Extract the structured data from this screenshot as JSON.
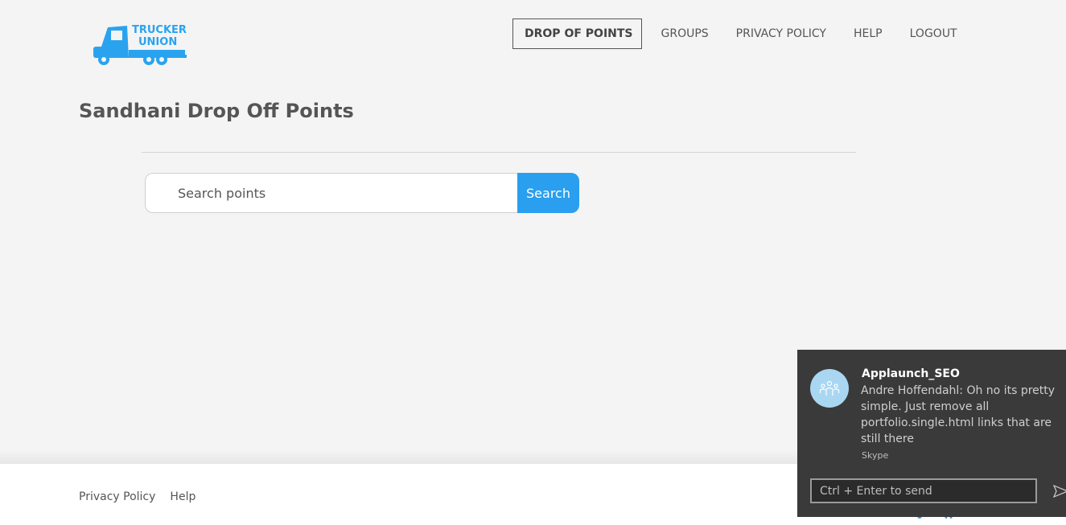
{
  "header": {
    "logo": {
      "line1": "TRUCKER",
      "line2": "UNI",
      "line2_o": "O",
      "line2_end": "N",
      "color": "#2aa3ef",
      "icon": "truck-icon"
    },
    "nav": [
      {
        "label": "DROP OF POINTS",
        "active": true
      },
      {
        "label": "GROUPS",
        "active": false
      },
      {
        "label": "PRIVACY POLICY",
        "active": false
      },
      {
        "label": "HELP",
        "active": false
      },
      {
        "label": "LOGOUT",
        "active": false
      }
    ]
  },
  "main": {
    "title_bold": "Sandhani",
    "title_rest": " Drop Off Points",
    "search": {
      "placeholder": "Search points",
      "button_label": "Search",
      "button_color": "#2a9ff0"
    }
  },
  "footer": {
    "links": [
      "Privacy Policy",
      "Help"
    ]
  },
  "notification": {
    "title": "Applaunch_SEO",
    "message": "Andre Hoffendahl: Oh no its pretty simple. Just remove all portfolio.single.html links that are still there",
    "source": "Skype",
    "reply_placeholder": "Ctrl + Enter to send",
    "avatar_icon": "group-icon",
    "send_icon": "send-icon",
    "background": "#3a3a3a"
  }
}
